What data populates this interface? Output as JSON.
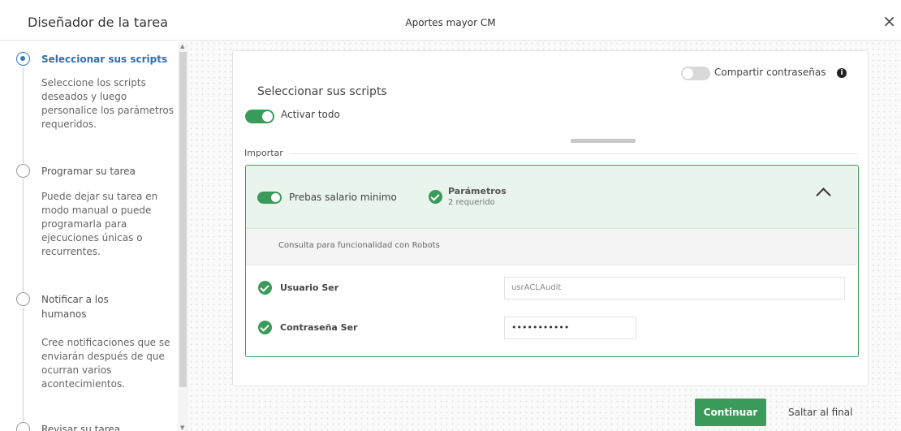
{
  "header": {
    "app_title": "Diseñador de la tarea",
    "task_name": "Aportes mayor CM",
    "close_glyph": "×"
  },
  "steps": [
    {
      "title": "Seleccionar sus scripts",
      "description": "Seleccione los scripts deseados y luego personalice los parámetros requeridos.",
      "active": true
    },
    {
      "title": "Programar su tarea",
      "description": "Puede dejar su tarea en modo manual o puede programarla para ejecuciones únicas o recurrentes.",
      "active": false
    },
    {
      "title": "Notificar a los humanos",
      "description": "Cree notificaciones que se enviarán después de que ocurran varios acontecimientos.",
      "active": false
    },
    {
      "title": "Revisar su tarea",
      "description": "",
      "active": false
    }
  ],
  "card": {
    "title": "Seleccionar sus scripts",
    "share_passwords": {
      "label": "Compartir contraseñas",
      "enabled": false,
      "info_icon": "info-icon"
    },
    "enable_all": {
      "label": "Activar todo",
      "enabled": true
    },
    "section_label": "Importar",
    "script": {
      "name": "Prebas salario minimo",
      "enabled": true,
      "params_title": "Parámetros",
      "params_sub": "2 requerido",
      "description": "Consulta para funcionalidad con Robots",
      "params": [
        {
          "label": "Usuario Ser",
          "value": "usrACLAudit"
        },
        {
          "label": "Contraseña Ser",
          "value": "•••••••••••"
        }
      ]
    }
  },
  "footer": {
    "continue_label": "Continuar",
    "skip_label": "Saltar al final"
  },
  "colors": {
    "accent_green": "#3a9a5a",
    "active_step_blue": "#2f6fb3"
  }
}
